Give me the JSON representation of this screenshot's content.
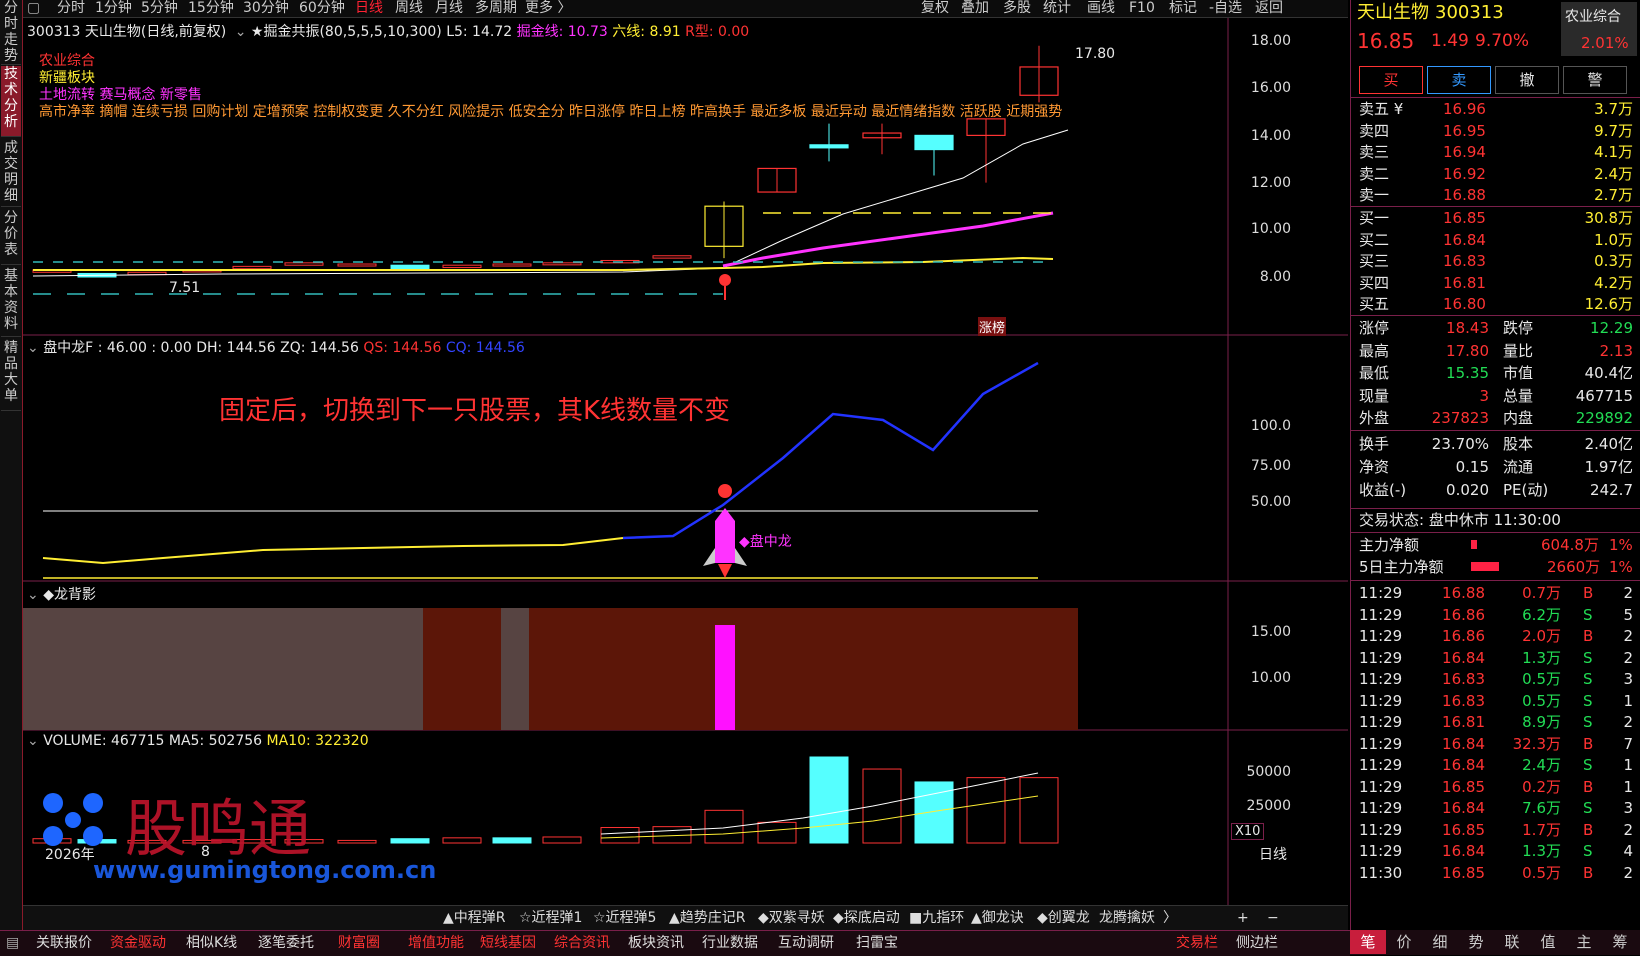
{
  "left_tabs": [
    "分时走势",
    "技术分析",
    "成交明细",
    "分价表",
    "基本资料",
    "精品大单"
  ],
  "toolbar": {
    "periods": [
      "分时",
      "1分钟",
      "5分钟",
      "15分钟",
      "30分钟",
      "60分钟",
      "日线",
      "周线",
      "月线",
      "多周期",
      "更多 〉"
    ],
    "tools": [
      "复权",
      "叠加",
      "多股",
      "统计",
      "画线",
      "F10",
      "标记",
      "-自选",
      "返回"
    ]
  },
  "main_info": {
    "title": "300313 天山生物(日线,前复权)",
    "indicator": "★掘金共振(80,5,5,5,10,300)",
    "l5": "L5: 14.72",
    "jj": "掘金线: 10.73",
    "lx": "六线: 8.91",
    "rx": "R型: 0.00",
    "tags": [
      "农业综合",
      "新疆板块",
      "土地流转 赛马概念 新零售"
    ],
    "warning": "高市净率 摘帽 连续亏损 回购计划 定增预案 控制权变更 久不分红 风险提示 低安全分 昨日涨停 昨日上榜 昨高换手 最近多板 最近异动 最近情绪指数 活跃股 近期强势",
    "high_label": "17.80",
    "low_label": "7.51",
    "zhangbang": "涨榜",
    "y_ticks": [
      "18.00",
      "16.00",
      "14.00",
      "12.00",
      "10.00",
      "8.00"
    ]
  },
  "panzhong": {
    "title": "盘中龙F : 46.00 : 0.00",
    "dh": "DH: 144.56",
    "zq": "ZQ: 144.56",
    "qs": "QS: 144.56",
    "cq": "CQ: 144.56",
    "note": "固定后，切换到下一只股票，其K线数量不变",
    "label": "◆盘中龙",
    "y_ticks": [
      "100.0",
      "75.00",
      "50.00"
    ]
  },
  "longbei": {
    "title": "◆龙背影",
    "y_ticks": [
      "15.00",
      "10.00"
    ]
  },
  "volume": {
    "title": "VOLUME: 467715",
    "ma5": "MA5: 502756",
    "ma10": "MA10: 322320",
    "y_ticks": [
      "50000",
      "25000"
    ],
    "x10": "X10",
    "date_year": "2026年",
    "date_month": "8",
    "rilian": "日线",
    "watermark": "股鸣通",
    "watermark_url": "www.gumingtong.com.cn"
  },
  "indicator_tabs": [
    "▲中程弹R",
    "☆近程弹1",
    "☆近程弹5",
    "▲趋势庄记R",
    "◆双紫寻妖",
    "◆探底启动",
    "■九指环",
    "▲御龙诀",
    "◆创翼龙",
    "龙腾擒妖",
    "〉"
  ],
  "bottom_bar": {
    "items": [
      "关联报价",
      "资金驱动",
      "相似K线",
      "逐笔委托",
      "财富圈",
      "增值功能",
      "短线基因",
      "综合资讯",
      "板块资讯",
      "行业数据",
      "互动调研",
      "扫雷宝"
    ],
    "right": [
      "交易栏",
      "侧边栏"
    ]
  },
  "stock": {
    "name": "天山生物",
    "code": "300313",
    "sector": "农业综合",
    "sector_chg": "2.01%",
    "price": "16.85",
    "change": "1.49",
    "pct": "9.70%"
  },
  "trade_buttons": [
    "买",
    "卖",
    "撤",
    "警"
  ],
  "asks": [
    {
      "label": "卖五 ¥",
      "price": "16.96",
      "vol": "3.7万"
    },
    {
      "label": "卖四",
      "price": "16.95",
      "vol": "9.7万"
    },
    {
      "label": "卖三",
      "price": "16.94",
      "vol": "4.1万"
    },
    {
      "label": "卖二",
      "price": "16.92",
      "vol": "2.4万"
    },
    {
      "label": "卖一",
      "price": "16.88",
      "vol": "2.7万"
    }
  ],
  "bids": [
    {
      "label": "买一",
      "price": "16.85",
      "vol": "30.8万"
    },
    {
      "label": "买二",
      "price": "16.84",
      "vol": "1.0万"
    },
    {
      "label": "买三",
      "price": "16.83",
      "vol": "0.3万"
    },
    {
      "label": "买四",
      "price": "16.81",
      "vol": "4.2万"
    },
    {
      "label": "买五",
      "price": "16.80",
      "vol": "12.6万"
    }
  ],
  "stats": [
    {
      "l1": "涨停",
      "v1": "18.43",
      "l2": "跌停",
      "v2": "12.29",
      "c1": "red",
      "c2": "green"
    },
    {
      "l1": "最高",
      "v1": "17.80",
      "l2": "量比",
      "v2": "2.13",
      "c1": "red",
      "c2": "red"
    },
    {
      "l1": "最低",
      "v1": "15.35",
      "l2": "市值",
      "v2": "40.4亿",
      "c1": "green",
      "c2": "white"
    },
    {
      "l1": "现量",
      "v1": "3",
      "l2": "总量",
      "v2": "467715",
      "c1": "red",
      "c2": "white"
    },
    {
      "l1": "外盘",
      "v1": "237823",
      "l2": "内盘",
      "v2": "229892",
      "c1": "red",
      "c2": "green"
    }
  ],
  "stats2": [
    {
      "l1": "换手",
      "v1": "23.70%",
      "l2": "股本",
      "v2": "2.40亿"
    },
    {
      "l1": "净资",
      "v1": "0.15",
      "l2": "流通",
      "v2": "1.97亿"
    },
    {
      "l1": "收益(-)",
      "v1": "0.020",
      "l2": "PE(动)",
      "v2": "242.7"
    }
  ],
  "trade_status": "交易状态: 盘中休市 11:30:00",
  "main_net": {
    "label": "主力净额",
    "value": "604.8万",
    "pct": "1%"
  },
  "main_net5": {
    "label": "5日主力净额",
    "value": "2660万",
    "pct": "1%"
  },
  "ticks": [
    {
      "t": "11:29",
      "p": "16.88",
      "v": "0.7万",
      "d": "B",
      "n": "2"
    },
    {
      "t": "11:29",
      "p": "16.86",
      "v": "6.2万",
      "d": "S",
      "n": "5"
    },
    {
      "t": "11:29",
      "p": "16.86",
      "v": "2.0万",
      "d": "B",
      "n": "2"
    },
    {
      "t": "11:29",
      "p": "16.84",
      "v": "1.3万",
      "d": "S",
      "n": "2"
    },
    {
      "t": "11:29",
      "p": "16.83",
      "v": "0.5万",
      "d": "S",
      "n": "3"
    },
    {
      "t": "11:29",
      "p": "16.83",
      "v": "0.5万",
      "d": "S",
      "n": "1"
    },
    {
      "t": "11:29",
      "p": "16.81",
      "v": "8.9万",
      "d": "S",
      "n": "2"
    },
    {
      "t": "11:29",
      "p": "16.84",
      "v": "32.3万",
      "d": "B",
      "n": "7"
    },
    {
      "t": "11:29",
      "p": "16.84",
      "v": "2.4万",
      "d": "S",
      "n": "1"
    },
    {
      "t": "11:29",
      "p": "16.85",
      "v": "0.2万",
      "d": "B",
      "n": "1"
    },
    {
      "t": "11:29",
      "p": "16.84",
      "v": "7.6万",
      "d": "S",
      "n": "3"
    },
    {
      "t": "11:29",
      "p": "16.85",
      "v": "1.7万",
      "d": "B",
      "n": "2"
    },
    {
      "t": "11:29",
      "p": "16.84",
      "v": "1.3万",
      "d": "S",
      "n": "4"
    },
    {
      "t": "11:30",
      "p": "16.85",
      "v": "0.5万",
      "d": "B",
      "n": "2"
    }
  ],
  "right_bottom_tabs": [
    "笔",
    "价",
    "细",
    "势",
    "联",
    "值",
    "主",
    "筹"
  ]
}
